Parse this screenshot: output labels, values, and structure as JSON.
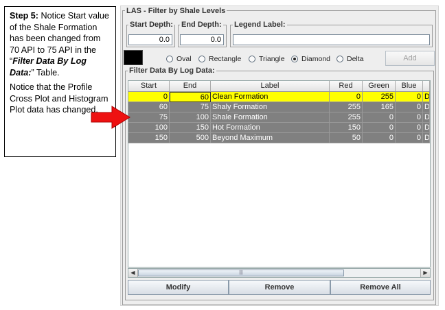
{
  "callout": {
    "step_label": "Step 5:",
    "text_a": " Notice Start value of the Shale Formation has been changed from 70 API to 75 API in the “",
    "emph": "Filter Data By Log Data:",
    "text_b": "” Table.",
    "para2": "Notice that the Profile Cross Plot and Histogram Plot data has changed."
  },
  "panel": {
    "title": "LAS - Filter by Shale Levels",
    "start_depth": {
      "label": "Start Depth:",
      "value": "0.0"
    },
    "end_depth": {
      "label": "End Depth:",
      "value": "0.0"
    },
    "legend_label": {
      "label": "Legend Label:",
      "value": ""
    },
    "shapes": [
      {
        "label": "Oval",
        "selected": false
      },
      {
        "label": "Rectangle",
        "selected": false
      },
      {
        "label": "Triangle",
        "selected": false
      },
      {
        "label": "Diamond",
        "selected": true
      },
      {
        "label": "Delta",
        "selected": false
      }
    ],
    "add_button": "Add",
    "filter_title": "Filter Data By Log Data:",
    "table": {
      "columns": [
        "Start",
        "End",
        "Label",
        "Red",
        "Green",
        "Blue",
        ""
      ],
      "rows": [
        {
          "start": "0",
          "end": "60",
          "label": "Clean Formation",
          "red": "0",
          "green": "255",
          "blue": "0",
          "extra": "D",
          "style": "selected"
        },
        {
          "start": "60",
          "end": "75",
          "label": "Shaly Formation",
          "red": "255",
          "green": "165",
          "blue": "0",
          "extra": "D",
          "style": "gray"
        },
        {
          "start": "75",
          "end": "100",
          "label": "Shale Formation",
          "red": "255",
          "green": "0",
          "blue": "0",
          "extra": "D",
          "style": "gray"
        },
        {
          "start": "100",
          "end": "150",
          "label": "Hot Formation",
          "red": "150",
          "green": "0",
          "blue": "0",
          "extra": "D",
          "style": "gray"
        },
        {
          "start": "150",
          "end": "500",
          "label": "Beyond Maximum",
          "red": "50",
          "green": "0",
          "blue": "0",
          "extra": "D",
          "style": "gray"
        }
      ]
    },
    "buttons": {
      "modify": "Modify",
      "remove": "Remove",
      "remove_all": "Remove All"
    }
  },
  "colors": {
    "selected_row": "#ffff00",
    "gray_row": "#808080",
    "arrow": "#ee1111",
    "color_swatch": "#000000"
  }
}
